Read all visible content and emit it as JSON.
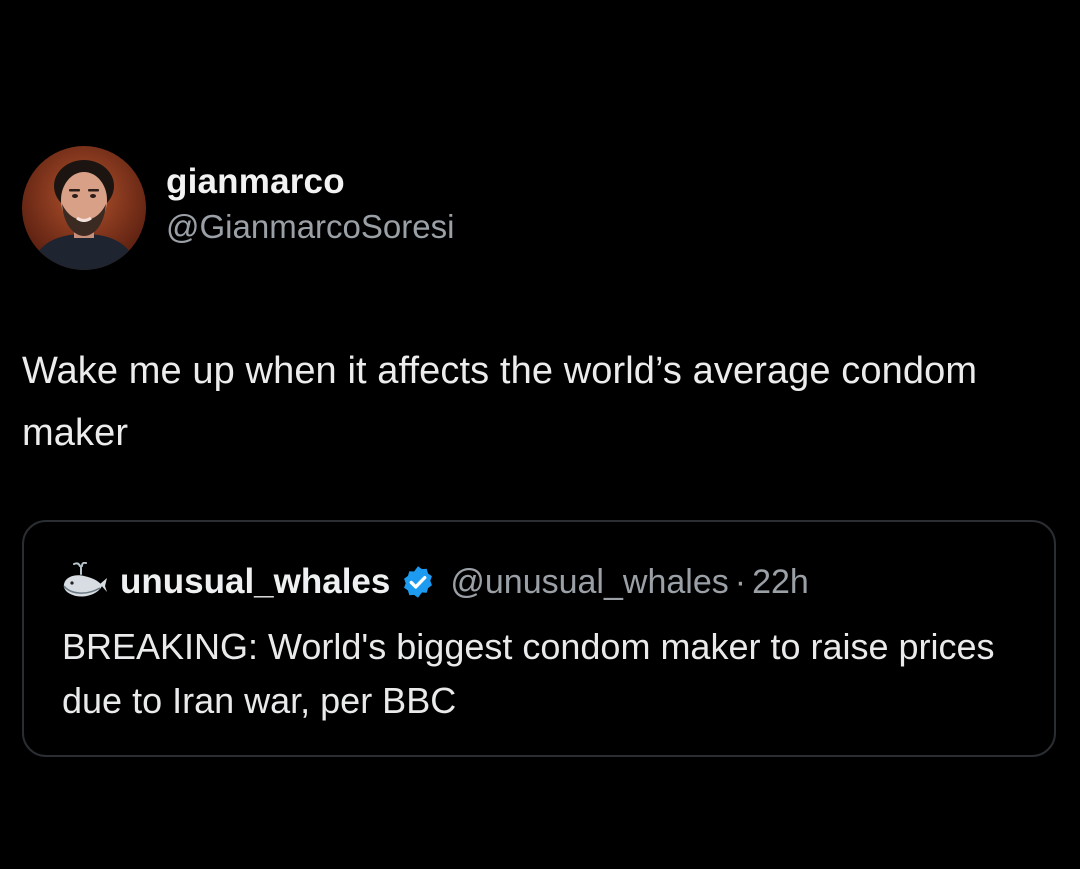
{
  "tweet": {
    "author": {
      "display_name": "gianmarco",
      "handle": "@GianmarcoSoresi",
      "avatar": "avatar-photo"
    },
    "text": "Wake me up when it affects the world’s average condom maker"
  },
  "quote": {
    "icon": "whale-icon",
    "display_name": "unusual_whales",
    "verified_icon": "verified-badge-icon",
    "handle": "@unusual_whales",
    "separator": "·",
    "time": "22h",
    "text": "BREAKING: World's biggest condom maker to raise prices due to Iran war, per BBC"
  },
  "colors": {
    "background": "#000000",
    "primary_text": "#e7e9ea",
    "secondary_text": "#9aa0a6",
    "card_border": "#2a2d31",
    "verified_blue": "#1d9bf0"
  }
}
